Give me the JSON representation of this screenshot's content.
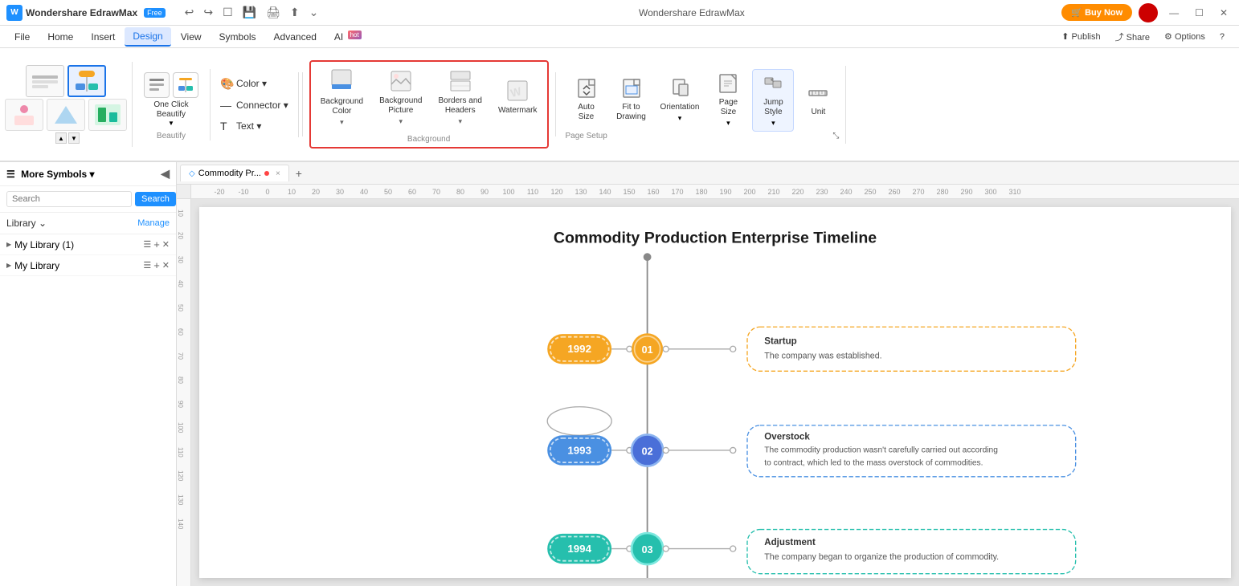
{
  "titlebar": {
    "app_name": "Wondershare EdrawMax",
    "free_badge": "Free",
    "undo": "↩",
    "redo": "↪",
    "new": "☐",
    "save": "💾",
    "print": "🖨",
    "export": "⬆",
    "more": "⌄",
    "buy_btn": "🛒 Buy Now",
    "win_minus": "—",
    "win_restore": "☐",
    "win_close": "✕"
  },
  "menubar": {
    "items": [
      "File",
      "Home",
      "Insert",
      "Design",
      "View",
      "Symbols",
      "Advanced"
    ],
    "active": "Design",
    "ai_label": "AI",
    "ai_badge": "hot"
  },
  "ribbon": {
    "one_click": {
      "label": "One Click\nBeautify",
      "arrow": "▼"
    },
    "beautify_items": [
      {
        "icon": "⊞",
        "selected": true
      },
      {
        "icon": "⊠"
      },
      {
        "icon": "⊡"
      },
      {
        "icon": "⊞"
      },
      {
        "icon": "⊡"
      }
    ],
    "beautify_label": "Beautify",
    "color_label": "Color ▾",
    "connector_label": "Connector ▾",
    "text_label": "Text ▾",
    "background_items": [
      {
        "icon": "🖼",
        "label": "Background\nColor",
        "arrow": "▾"
      },
      {
        "icon": "🖼",
        "label": "Background\nPicture",
        "arrow": "▾"
      },
      {
        "icon": "📋",
        "label": "Borders and\nHeaders",
        "arrow": "▾"
      },
      {
        "icon": "🔲",
        "label": "Watermark",
        "arrow": "▾"
      }
    ],
    "background_label": "Background",
    "page_setup_items": [
      {
        "icon": "📄",
        "label": "Auto\nSize"
      },
      {
        "icon": "📄",
        "label": "Fit to\nDrawing"
      },
      {
        "icon": "📄",
        "label": "Orientation",
        "arrow": "▾"
      },
      {
        "icon": "📄",
        "label": "Page\nSize",
        "arrow": "▾"
      },
      {
        "icon": "📏",
        "label": "Jump\nStyle",
        "arrow": "▾"
      },
      {
        "icon": "📏",
        "label": "Unit"
      }
    ],
    "page_setup_label": "Page Setup"
  },
  "publish_btn": "⬆ Publish",
  "share_btn": "⤴ Share",
  "options_btn": "⚙ Options",
  "help_btn": "?",
  "sidebar": {
    "title": "More Symbols ▾",
    "collapse": "◀",
    "search_placeholder": "Search",
    "search_btn": "Search",
    "library_title": "Library ⌄",
    "manage_btn": "Manage",
    "my_library_1": "My Library (1)",
    "my_library_2": "My Library",
    "lib_icon": "☰",
    "lib_add": "+",
    "lib_close": "✕"
  },
  "tabs": {
    "items": [
      {
        "icon": "◇",
        "label": "Commodity Pr...",
        "dot": true,
        "close": "×"
      }
    ],
    "add": "+"
  },
  "ruler": {
    "marks": [
      "-20",
      "-10",
      "0",
      "10",
      "20",
      "30",
      "40",
      "50",
      "60",
      "70",
      "80",
      "90",
      "100",
      "110",
      "120",
      "130",
      "140",
      "150",
      "160",
      "170",
      "180",
      "190",
      "200",
      "210",
      "220",
      "230",
      "240",
      "250",
      "260",
      "270",
      "280",
      "290",
      "300",
      "310"
    ]
  },
  "canvas": {
    "title": "Commodity Production Enterprise Timeline",
    "events": [
      {
        "year": "1992",
        "year_color": "#f5a623",
        "num": "01",
        "num_color": "#f5a623",
        "event_title": "Startup",
        "event_text": "The company was established.",
        "box_color": "#f5a623"
      },
      {
        "year": "1993",
        "year_color": "#4a90e2",
        "num": "02",
        "num_color": "#4a6fd8",
        "event_title": "Overstock",
        "event_text": "The commodity production wasn't carefully carried out according to contract, which led to the mass overstock of commodities.",
        "box_color": "#4a90e2"
      },
      {
        "year": "1994",
        "year_color": "#26bfad",
        "num": "03",
        "num_color": "#26bfad",
        "event_title": "Adjustment",
        "event_text": "The company began to organize the production of commodity.",
        "box_color": "#26bfad"
      }
    ]
  }
}
